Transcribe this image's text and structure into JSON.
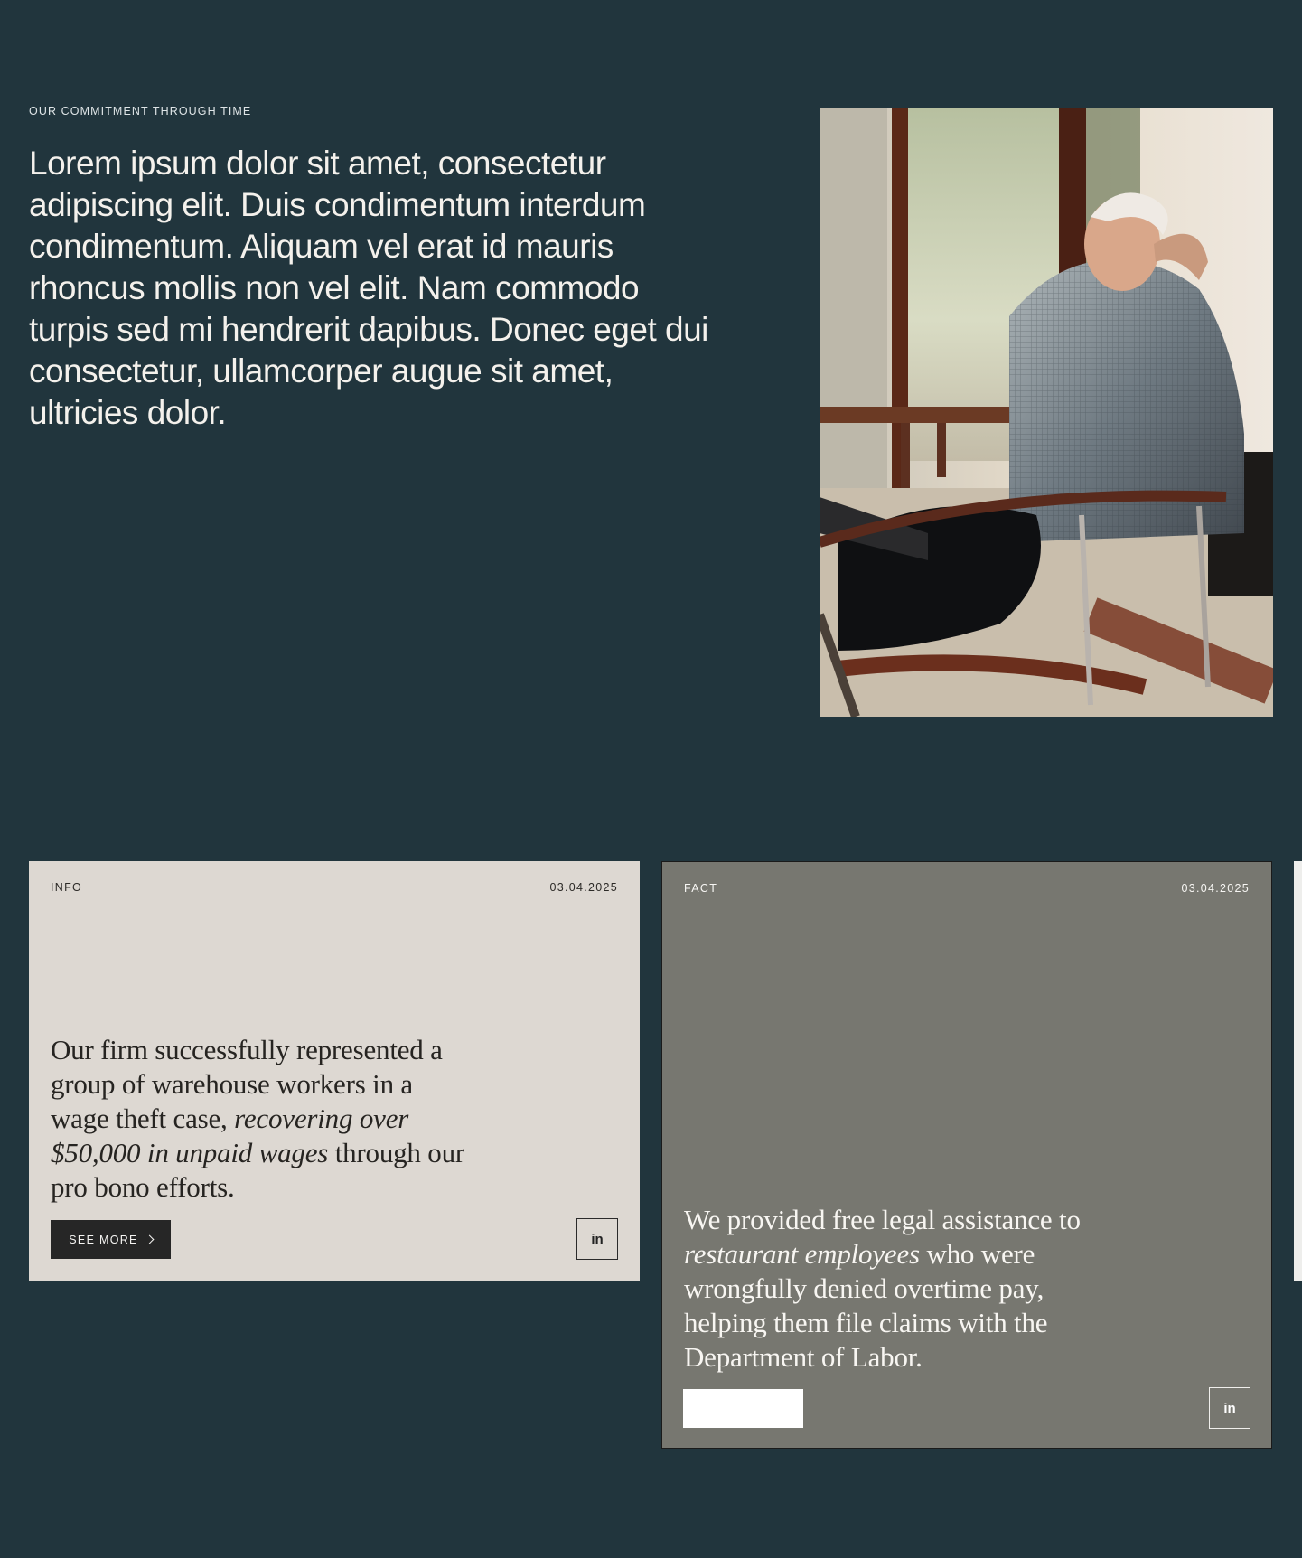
{
  "intro": {
    "eyebrow": "OUR COMMITMENT THROUGH TIME",
    "paragraph": "Lorem ipsum dolor sit amet, consectetur adipiscing elit. Duis condimentum interdum condimentum. Aliquam vel erat id mauris rhoncus mollis non vel elit. Nam commodo turpis sed mi hendrerit dapibus. Donec eget dui consectetur, ullamcorper augue sit amet, ultricies dolor."
  },
  "cards": [
    {
      "tag": "INFO",
      "date": "03.04.2025",
      "text_before": "Our firm successfully represented a group of warehouse workers in a wage theft case, ",
      "text_emphasis": "recovering over $50,000 in unpaid wages",
      "text_after": " through our pro bono efforts.",
      "button_label": "SEE MORE",
      "social_label": "in"
    },
    {
      "tag": "FACT",
      "date": "03.04.2025",
      "text_before": "We provided free legal assistance to ",
      "text_emphasis": "restaurant employees",
      "text_after": " who were wrongfully denied overtime pay, helping them file claims with the Department of Labor.",
      "social_label": "in"
    }
  ],
  "colors": {
    "page_background": "#21353d",
    "info_card": "#ddd8d2",
    "fact_card": "#777770",
    "dark_button": "#262626"
  },
  "icons": {
    "see_more_arrow": "chevron-right-icon",
    "social": "linkedin-icon"
  }
}
